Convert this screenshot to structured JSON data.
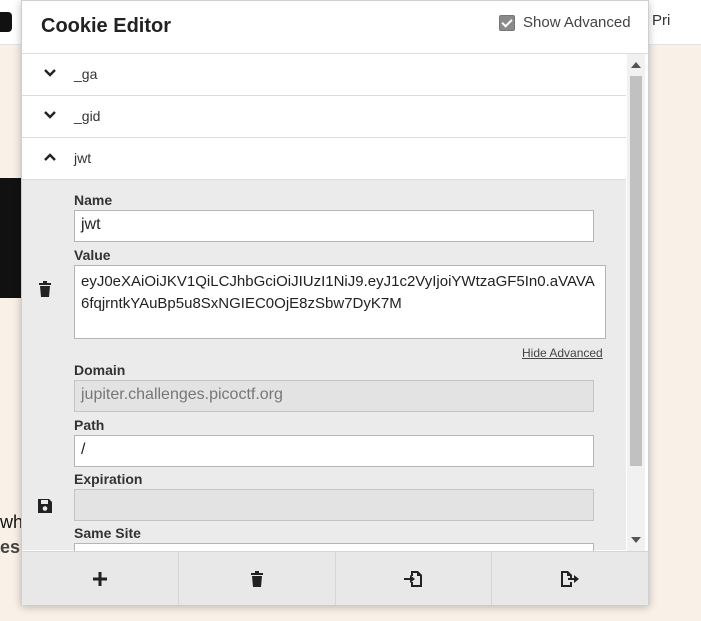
{
  "background": {
    "nav_text": "Pri",
    "text_line_1": "wh",
    "text_line_2": "es"
  },
  "popup": {
    "title": "Cookie Editor",
    "show_advanced_label": "Show Advanced",
    "show_advanced_checked": true
  },
  "cookies": [
    {
      "name": "_ga",
      "expanded": false
    },
    {
      "name": "_gid",
      "expanded": false
    },
    {
      "name": "jwt",
      "expanded": true
    }
  ],
  "details": {
    "name_label": "Name",
    "name_value": "jwt",
    "value_label": "Value",
    "value_text": "eyJ0eXAiOiJKV1QiLCJhbGciOiJIUzI1NiJ9.eyJ1c2VyIjoiYWtzaGF5In0.aVAVA6fqjrntkYAuBp5u8SxNGIEC0OjE8zSbw7DyK7M",
    "hide_advanced": "Hide Advanced",
    "domain_label": "Domain",
    "domain_value": "jupiter.challenges.picoctf.org",
    "path_label": "Path",
    "path_value": "/",
    "expiration_label": "Expiration",
    "expiration_value": "",
    "same_site_label": "Same Site"
  },
  "footer": {
    "buttons": [
      "add-icon",
      "trash-icon",
      "import-icon",
      "export-icon"
    ]
  },
  "icons": {
    "chevron_down": "chevron-down-icon",
    "chevron_up": "chevron-up-icon",
    "delete": "trash-icon",
    "save": "save-icon"
  }
}
